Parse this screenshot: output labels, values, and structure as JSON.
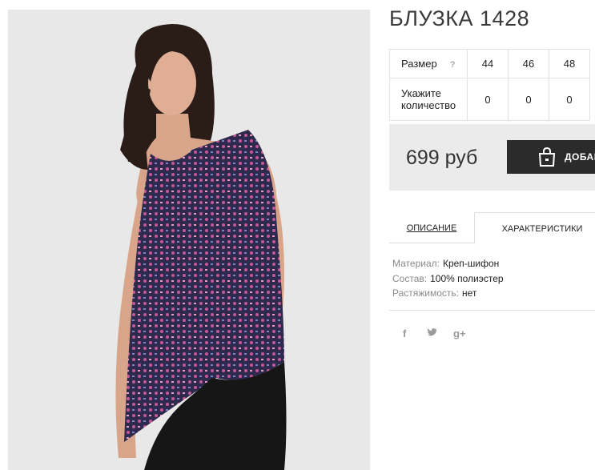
{
  "product": {
    "title": "БЛУЗКА 1428",
    "photo_alt": "product-photo"
  },
  "sizes": {
    "size_label": "Размер",
    "help": "?",
    "values": [
      "44",
      "46",
      "48"
    ],
    "qty_label_line1": "Укажите",
    "qty_label_line2": "количество",
    "quantities": [
      "0",
      "0",
      "0"
    ]
  },
  "buy": {
    "price": "699 руб",
    "add_label": "ДОБАВ"
  },
  "tabs": [
    {
      "label": "ОПИСАНИЕ",
      "active": false
    },
    {
      "label": "ХАРАКТЕРИСТИКИ",
      "active": true
    }
  ],
  "specs": [
    {
      "key": "Материал:",
      "value": "Креп-шифон"
    },
    {
      "key": "Состав:",
      "value": "100% полиэстер"
    },
    {
      "key": "Растяжимость:",
      "value": "нет"
    }
  ],
  "social": [
    {
      "icon": "facebook-icon",
      "glyph": "f"
    },
    {
      "icon": "twitter-icon",
      "glyph": "🐦"
    },
    {
      "icon": "google-plus-icon",
      "glyph": "g+"
    }
  ],
  "colors": {
    "button_bg": "#2b2b2b",
    "buybar_bg": "#ebebeb",
    "blouse_navy": "#2e2a4e",
    "blouse_pink": "#c8569a"
  }
}
